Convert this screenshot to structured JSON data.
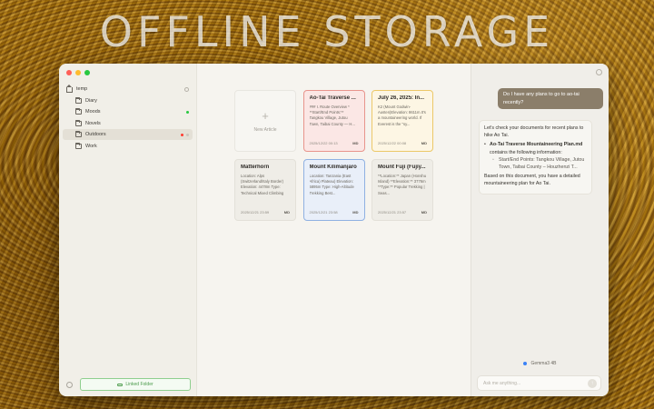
{
  "headline": "OFFLINE STORAGE",
  "sidebar": {
    "root": {
      "label": "temp",
      "icon": "home-icon"
    },
    "folders": [
      {
        "label": "Diary",
        "icon": "folder-icon",
        "active": false,
        "status_color": ""
      },
      {
        "label": "Moods",
        "icon": "folder-icon",
        "active": false,
        "status_color": "#28c840"
      },
      {
        "label": "Novels",
        "icon": "folder-icon",
        "active": false,
        "status_color": ""
      },
      {
        "label": "Outdoors",
        "icon": "folder-icon",
        "active": true,
        "status_color": "#ff3b30"
      },
      {
        "label": "Work",
        "icon": "folder-icon",
        "active": false,
        "status_color": ""
      }
    ],
    "linked_folder_label": "Linked Folder"
  },
  "main": {
    "new_article_label": "New Article",
    "cards": [
      {
        "title": "Ao-Tai Traverse ...",
        "body": "### I. Route Overview * **Start/End Points:** Tangkou Village, Jutou Town, Taibai County — H...",
        "date": "2025/12/22 00:13",
        "badge": "MD",
        "accent": "red"
      },
      {
        "title": "July 26, 2025: In...",
        "body": "K2 (Mount Godwin-Austen)Elevation: 8611m.It's a mountaineering world. If Everest is the \"sy...",
        "date": "2025/12/22 00:08",
        "badge": "MD",
        "accent": "yellow"
      },
      {
        "title": "Matterhorn",
        "body": "Location: Alps (Switzerland/Italy Border) Elevation: 4478m Type: Technical Mixed Climbing (Rock ...",
        "date": "2025/12/21 23:59",
        "badge": "MD",
        "accent": "none"
      },
      {
        "title": "Mount Kilimanjaro",
        "body": "Location: Tanzania (East Africa) Plateau) Elevation: 5895m Type: High-Altitude Trekking Best...",
        "date": "2025/12/21 23:58",
        "badge": "MD",
        "accent": "blue"
      },
      {
        "title": "Mount Fuji (Fujiy...",
        "body": "**Location:** Japan (Honshu Island) **Elevation:** 3776m **Type:** Popular Trekking | Seas...",
        "date": "2025/12/21 23:57",
        "badge": "MD",
        "accent": "none"
      }
    ]
  },
  "chat": {
    "user_message": "Do I have any plans to go to ao-tai recently?",
    "ai_intro": "Let's check your documents for recent plans to hike Ao Tai.",
    "ai_file_title": "Ao-Tai Traverse Mountaineering Plan.md",
    "ai_file_suffix": " contains the following information:",
    "ai_sub_item": "Start/End Points: Tangkou Village, Jutou Town, Taibai County – Houzhenzi T...",
    "ai_conclusion": "Based on this document, you have a detailed mountaineering plan for Ao Tai.",
    "model_name": "Gemma3 4B",
    "input_placeholder": "Ask me anything...",
    "input_value": ""
  },
  "colors": {
    "red_accent": "#e8948c",
    "yellow_accent": "#ecc868",
    "blue_accent": "#8fb1e2",
    "user_bubble": "#8b7e6a",
    "linked_folder": "#4a9a4a"
  }
}
